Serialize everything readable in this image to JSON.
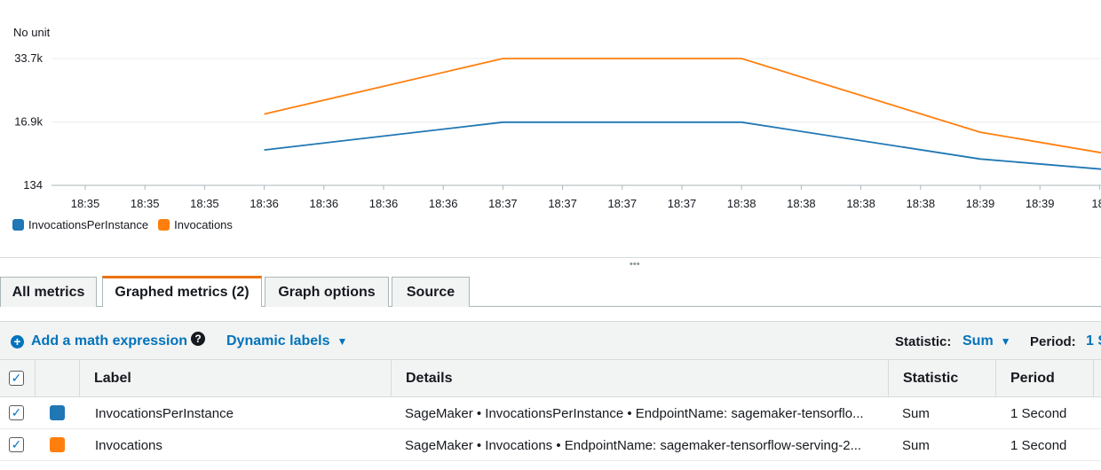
{
  "chart": {
    "unit_label": "No unit",
    "y_ticks": [
      "33.7k",
      "16.9k",
      "134"
    ],
    "x_ticks": [
      "18:35",
      "18:35",
      "18:35",
      "18:36",
      "18:36",
      "18:36",
      "18:36",
      "18:37",
      "18:37",
      "18:37",
      "18:37",
      "18:38",
      "18:38",
      "18:38",
      "18:38",
      "18:39",
      "18:39",
      "18:"
    ],
    "legend": [
      {
        "name": "InvocationsPerInstance",
        "color": "#1f77b4"
      },
      {
        "name": "Invocations",
        "color": "#ff7f0e"
      }
    ]
  },
  "chart_data": {
    "type": "line",
    "ylabel": "No unit",
    "ylim": [
      134,
      33700
    ],
    "y_tick_values": [
      134,
      16900,
      33700
    ],
    "x_index_range": [
      0,
      17
    ],
    "series": [
      {
        "name": "InvocationsPerInstance",
        "color": "#1f77b4",
        "points": [
          [
            3,
            9500
          ],
          [
            7,
            16850
          ],
          [
            11,
            16850
          ],
          [
            15,
            7100
          ],
          [
            17.5,
            3800
          ]
        ]
      },
      {
        "name": "Invocations",
        "color": "#ff7f0e",
        "points": [
          [
            3,
            19000
          ],
          [
            7,
            33700
          ],
          [
            11,
            33700
          ],
          [
            15,
            14200
          ],
          [
            17.5,
            7500
          ]
        ]
      }
    ]
  },
  "drag_handle": "•••",
  "tabs": [
    {
      "label": "All metrics"
    },
    {
      "label": "Graphed metrics (2)"
    },
    {
      "label": "Graph options"
    },
    {
      "label": "Source"
    }
  ],
  "toolbar": {
    "add_math": "Add a math expression",
    "dynamic_labels": "Dynamic labels",
    "statistic_label": "Statistic:",
    "statistic_value": "Sum",
    "period_label": "Period:",
    "period_value": "1 S"
  },
  "table": {
    "headers": {
      "label": "Label",
      "details": "Details",
      "statistic": "Statistic",
      "period": "Period"
    },
    "rows": [
      {
        "label": "InvocationsPerInstance",
        "color": "#1f77b4",
        "details": "SageMaker • InvocationsPerInstance • EndpointName: sagemaker-tensorflo...",
        "statistic": "Sum",
        "period": "1 Second"
      },
      {
        "label": "Invocations",
        "color": "#ff7f0e",
        "details": "SageMaker • Invocations • EndpointName: sagemaker-tensorflow-serving-2...",
        "statistic": "Sum",
        "period": "1 Second"
      }
    ]
  }
}
